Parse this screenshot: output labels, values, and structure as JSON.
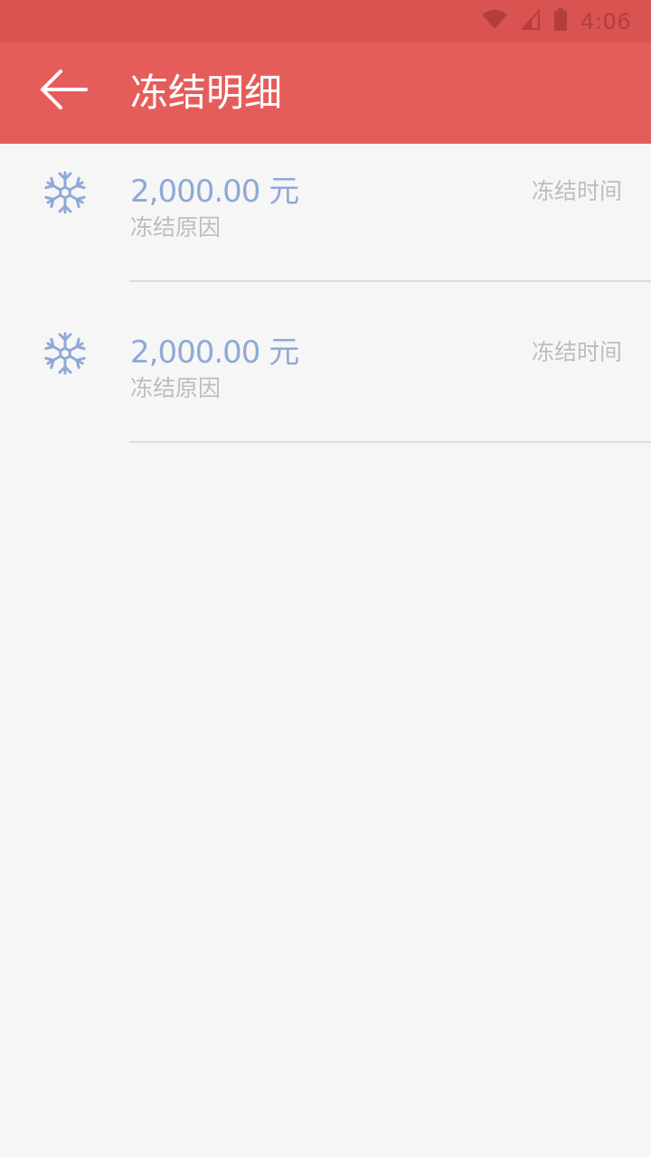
{
  "status_bar": {
    "time": "4:06",
    "icons": [
      "wifi-icon",
      "signal-icon",
      "battery-icon"
    ]
  },
  "app_bar": {
    "back_icon": "arrow-left-icon",
    "title": "冻结明细"
  },
  "colors": {
    "status_bar": "#d95350",
    "app_bar": "#e55d5b",
    "accent_blue": "#8fa9d6",
    "secondary_text": "#bdbdbd",
    "background": "#f6f6f6"
  },
  "freeze_items": [
    {
      "icon": "snowflake-icon",
      "amount": "2,000.00 元",
      "reason": "冻结原因",
      "time": "冻结时间"
    },
    {
      "icon": "snowflake-icon",
      "amount": "2,000.00 元",
      "reason": "冻结原因",
      "time": "冻结时间"
    }
  ]
}
